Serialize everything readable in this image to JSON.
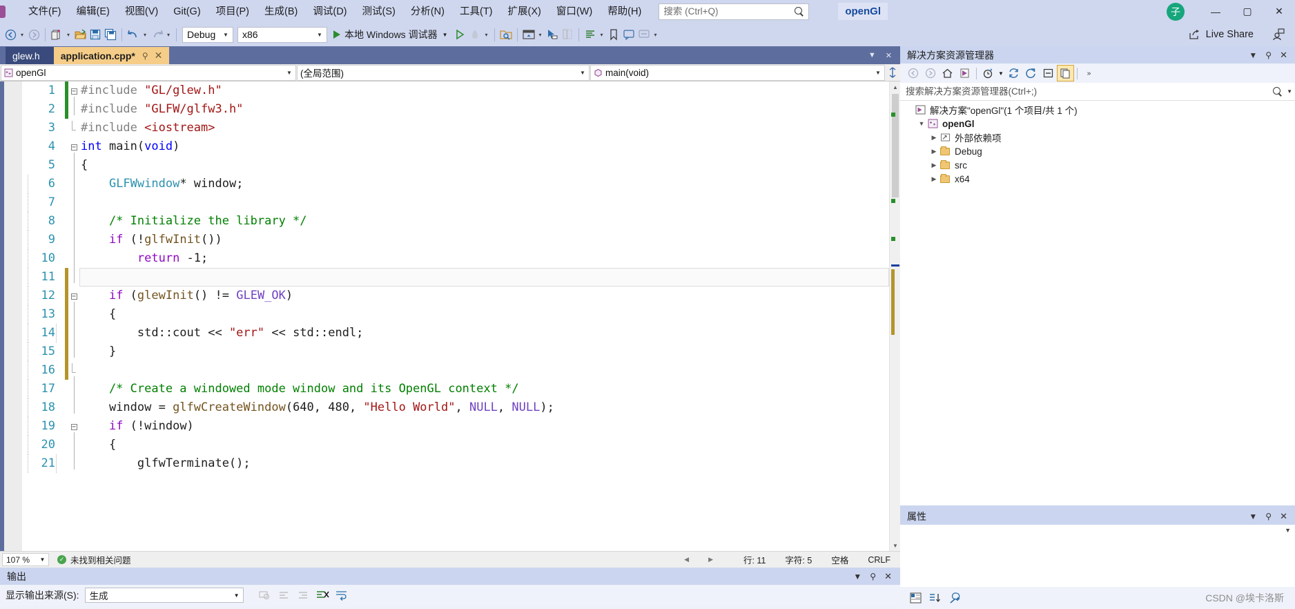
{
  "titlebar": {
    "menus": [
      "文件(F)",
      "编辑(E)",
      "视图(V)",
      "Git(G)",
      "项目(P)",
      "生成(B)",
      "调试(D)",
      "测试(S)",
      "分析(N)",
      "工具(T)",
      "扩展(X)",
      "窗口(W)",
      "帮助(H)"
    ],
    "search_placeholder": "搜索 (Ctrl+Q)",
    "search_value": "",
    "solution_name": "openGl",
    "avatar_initial": "子",
    "minimize": "—",
    "maximize": "▢",
    "close": "✕"
  },
  "toolbar": {
    "config": "Debug",
    "platform": "x86",
    "run_label": "本地 Windows 调试器",
    "live_share": "Live Share"
  },
  "editor": {
    "tabs": [
      {
        "label": "glew.h",
        "active": false,
        "modified": false
      },
      {
        "label": "application.cpp*",
        "active": true,
        "modified": true
      }
    ],
    "nav": {
      "project": "openGl",
      "scope": "(全局范围)",
      "member": "main(void)"
    },
    "lines": [
      {
        "n": 1,
        "change": "green",
        "fold": "minus",
        "segs": [
          {
            "t": "#include ",
            "c": "k-pre"
          },
          {
            "t": "\"GL/glew.h\"",
            "c": "k-str"
          }
        ],
        "indent": 0
      },
      {
        "n": 2,
        "change": "green",
        "fold": "bar",
        "segs": [
          {
            "t": "#include ",
            "c": "k-pre"
          },
          {
            "t": "\"GLFW/glfw3.h\"",
            "c": "k-str"
          }
        ],
        "indent": 0
      },
      {
        "n": 3,
        "change": "",
        "fold": "end",
        "segs": [
          {
            "t": "#include ",
            "c": "k-pre"
          },
          {
            "t": "<iostream>",
            "c": "k-str"
          }
        ],
        "indent": 0
      },
      {
        "n": 4,
        "change": "",
        "fold": "minus",
        "segs": [
          {
            "t": "int",
            "c": "k-key"
          },
          {
            "t": " main",
            "c": "k-pln"
          },
          {
            "t": "(",
            "c": "k-pln"
          },
          {
            "t": "void",
            "c": "k-key"
          },
          {
            "t": ")",
            "c": "k-pln"
          }
        ],
        "indent": 0
      },
      {
        "n": 5,
        "change": "",
        "fold": "bar",
        "segs": [
          {
            "t": "{",
            "c": "k-pln"
          }
        ],
        "indent": 0
      },
      {
        "n": 6,
        "change": "",
        "fold": "bar",
        "segs": [
          {
            "t": "    ",
            "c": "k-pln"
          },
          {
            "t": "GLFWwindow",
            "c": "k-typ"
          },
          {
            "t": "* window;",
            "c": "k-pln"
          }
        ],
        "indent": 1
      },
      {
        "n": 7,
        "change": "",
        "fold": "bar",
        "segs": [],
        "indent": 1
      },
      {
        "n": 8,
        "change": "",
        "fold": "bar",
        "segs": [
          {
            "t": "    /* Initialize the library */",
            "c": "k-cmt"
          }
        ],
        "indent": 1
      },
      {
        "n": 9,
        "change": "",
        "fold": "bar",
        "segs": [
          {
            "t": "    ",
            "c": "k-pln"
          },
          {
            "t": "if",
            "c": "k-ctl"
          },
          {
            "t": " (!",
            "c": "k-pln"
          },
          {
            "t": "glfwInit",
            "c": "k-fn"
          },
          {
            "t": "())",
            "c": "k-pln"
          }
        ],
        "indent": 1
      },
      {
        "n": 10,
        "change": "",
        "fold": "bar",
        "segs": [
          {
            "t": "        ",
            "c": "k-pln"
          },
          {
            "t": "return",
            "c": "k-ctl"
          },
          {
            "t": " -1;",
            "c": "k-pln"
          }
        ],
        "indent": 1
      },
      {
        "n": 11,
        "change": "gold",
        "fold": "bar",
        "segs": [],
        "indent": 1,
        "current": true
      },
      {
        "n": 12,
        "change": "gold",
        "fold": "minus",
        "segs": [
          {
            "t": "    ",
            "c": "k-pln"
          },
          {
            "t": "if",
            "c": "k-ctl"
          },
          {
            "t": " (",
            "c": "k-pln"
          },
          {
            "t": "glewInit",
            "c": "k-fn"
          },
          {
            "t": "() != ",
            "c": "k-pln"
          },
          {
            "t": "GLEW_OK",
            "c": "k-mac"
          },
          {
            "t": ")",
            "c": "k-pln"
          }
        ],
        "indent": 1
      },
      {
        "n": 13,
        "change": "gold",
        "fold": "bar",
        "segs": [
          {
            "t": "    {",
            "c": "k-pln"
          }
        ],
        "indent": 1
      },
      {
        "n": 14,
        "change": "gold",
        "fold": "bar",
        "segs": [
          {
            "t": "        std::cout << ",
            "c": "k-pln"
          },
          {
            "t": "\"err\"",
            "c": "k-str"
          },
          {
            "t": " << std::endl;",
            "c": "k-pln"
          }
        ],
        "indent": 2
      },
      {
        "n": 15,
        "change": "gold",
        "fold": "bar",
        "segs": [
          {
            "t": "    }",
            "c": "k-pln"
          }
        ],
        "indent": 1
      },
      {
        "n": 16,
        "change": "gold",
        "fold": "end",
        "segs": [],
        "indent": 1
      },
      {
        "n": 17,
        "change": "",
        "fold": "bar",
        "segs": [
          {
            "t": "    /* Create a windowed mode window and its OpenGL context */",
            "c": "k-cmt"
          }
        ],
        "indent": 1
      },
      {
        "n": 18,
        "change": "",
        "fold": "bar",
        "segs": [
          {
            "t": "    window = ",
            "c": "k-pln"
          },
          {
            "t": "glfwCreateWindow",
            "c": "k-fn"
          },
          {
            "t": "(640, 480, ",
            "c": "k-pln"
          },
          {
            "t": "\"Hello World\"",
            "c": "k-str"
          },
          {
            "t": ", ",
            "c": "k-pln"
          },
          {
            "t": "NULL",
            "c": "k-mac"
          },
          {
            "t": ", ",
            "c": "k-pln"
          },
          {
            "t": "NULL",
            "c": "k-mac"
          },
          {
            "t": ");",
            "c": "k-pln"
          }
        ],
        "indent": 1
      },
      {
        "n": 19,
        "change": "",
        "fold": "minus",
        "segs": [
          {
            "t": "    ",
            "c": "k-pln"
          },
          {
            "t": "if",
            "c": "k-ctl"
          },
          {
            "t": " (!window)",
            "c": "k-pln"
          }
        ],
        "indent": 1
      },
      {
        "n": 20,
        "change": "",
        "fold": "bar",
        "segs": [
          {
            "t": "    {",
            "c": "k-pln"
          }
        ],
        "indent": 1
      },
      {
        "n": 21,
        "change": "",
        "fold": "bar",
        "segs": [
          {
            "t": "        glfwTerminate();",
            "c": "k-pln"
          }
        ],
        "indent": 2
      }
    ],
    "status": {
      "zoom": "107 %",
      "problems": "未找到相关问题",
      "line_label": "行: 11",
      "col_label": "字符: 5",
      "spaces": "空格",
      "eol": "CRLF"
    }
  },
  "output": {
    "title": "输出",
    "source_label": "显示输出来源(S):",
    "source_value": "生成"
  },
  "solution_explorer": {
    "title": "解决方案资源管理器",
    "search_placeholder": "搜索解决方案资源管理器(Ctrl+;)",
    "search_value": "",
    "tree": [
      {
        "label": "解决方案\"openGl\"(1 个项目/共 1 个)",
        "level": 0,
        "icon": "solution-icon",
        "expander": "",
        "bold": false
      },
      {
        "label": "openGl",
        "level": 1,
        "icon": "project-icon",
        "expander": "▼",
        "bold": true
      },
      {
        "label": "外部依赖项",
        "level": 2,
        "icon": "dependencies-icon",
        "expander": "▶",
        "bold": false
      },
      {
        "label": "Debug",
        "level": 2,
        "icon": "folder-icon",
        "expander": "▶",
        "bold": false
      },
      {
        "label": "src",
        "level": 2,
        "icon": "folder-icon",
        "expander": "▶",
        "bold": false
      },
      {
        "label": "x64",
        "level": 2,
        "icon": "folder-icon",
        "expander": "▶",
        "bold": false
      }
    ]
  },
  "properties": {
    "title": "属性"
  },
  "watermark": "CSDN @埃卡洛斯",
  "colors": {
    "chrome": "#cfd7ef",
    "accent_blue": "#16499c",
    "tab_active": "#f5cd88",
    "tab_inactive": "#3a4a7c",
    "panel_border": "#5d6e9e"
  }
}
